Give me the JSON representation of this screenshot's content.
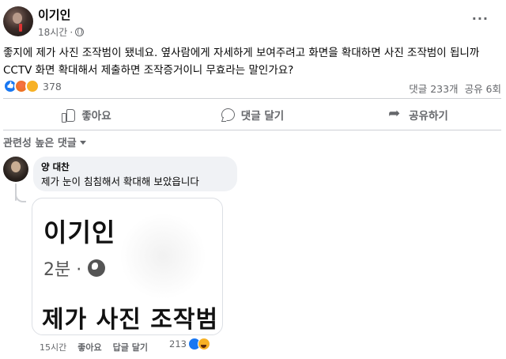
{
  "post": {
    "author": "이기인",
    "time": "18시간",
    "privacy_icon": "globe-icon",
    "text": "좋지에 제가 사진 조작범이 됐네요. 옆사람에게 자세하게 보여주려고 화면을 확대하면 사진 조작범이 됩니까 CCTV 화면 확대해서 제출하면 조작증거이니 무효라는 말인가요?",
    "reaction_count": "378",
    "reaction_icons": [
      "like",
      "angry",
      "sad"
    ],
    "comments": "댓글 233개",
    "shares": "공유 6회"
  },
  "actions": {
    "like": "좋아요",
    "comment": "댓글 달기",
    "share": "공유하기"
  },
  "filter": {
    "label": "관련성 높은 댓글"
  },
  "comment": {
    "author": "양 대찬",
    "text": "제가 눈이 침침해서 확대해 보았읍니다",
    "time": "15시간",
    "like": "좋아요",
    "reply": "답글 달기",
    "reaction_count": "213",
    "reaction_icons": [
      "like",
      "haha"
    ],
    "image": {
      "name": "이기인",
      "meta": "2분 ·",
      "text": "제가 사진 조작범"
    }
  },
  "colors": {
    "accent": "#1877f2",
    "text_secondary": "#65676b",
    "bubble": "#f0f2f5"
  }
}
